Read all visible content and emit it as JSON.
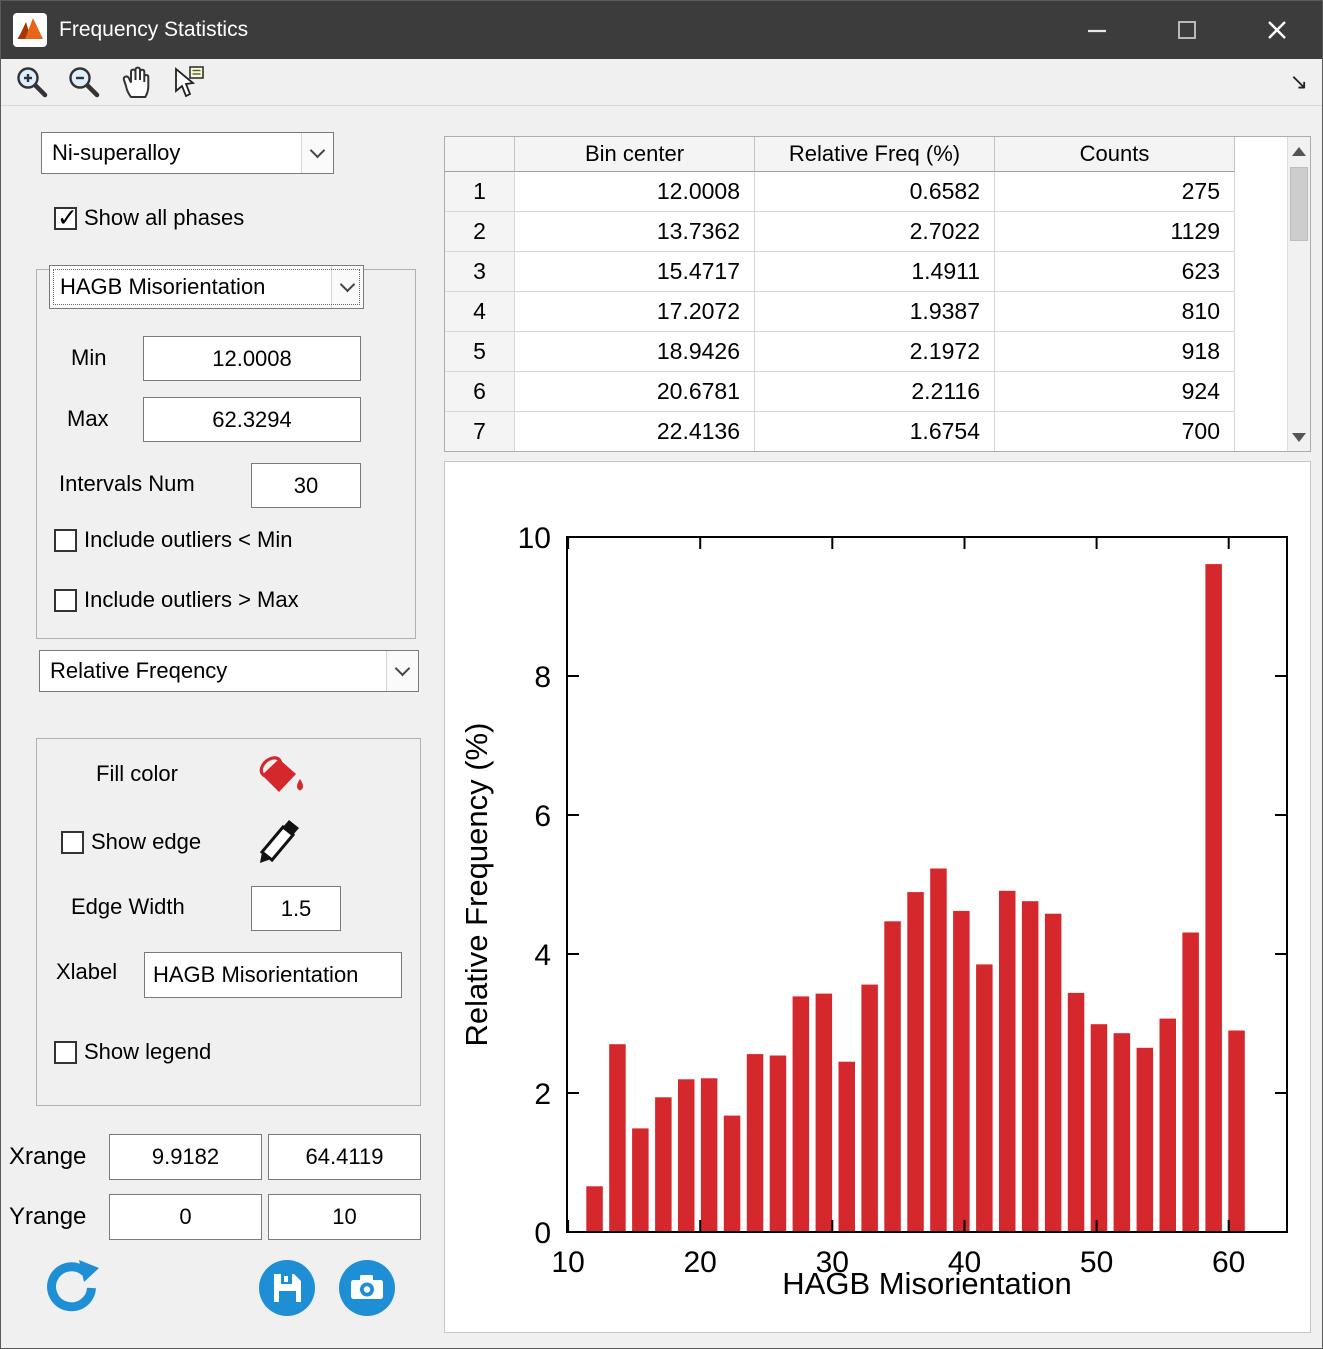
{
  "window": {
    "title": "Frequency Statistics"
  },
  "toolbar": {
    "icons": [
      "zoom-in-icon",
      "zoom-out-icon",
      "pan-hand-icon",
      "data-cursor-icon",
      "dock-arrow-icon"
    ],
    "dock_arrow": "↘"
  },
  "left_panel": {
    "phase_select": "Ni-superalloy",
    "show_all_phases": "Show all phases",
    "show_all_phases_checked": true,
    "property_select": "HAGB Misorientation",
    "min_label": "Min",
    "min_value": "12.0008",
    "max_label": "Max",
    "max_value": "62.3294",
    "intervals_label": "Intervals Num",
    "intervals_value": "30",
    "outlier_min_label": "Include outliers < Min",
    "outlier_min_checked": false,
    "outlier_max_label": "Include outliers > Max",
    "outlier_max_checked": false,
    "freq_select": "Relative Freqency",
    "fill_color_label": "Fill color",
    "fill_color": "#d5282c",
    "show_edge_label": "Show edge",
    "show_edge_checked": false,
    "edge_width_label": "Edge Width",
    "edge_width_value": "1.5",
    "xlabel_label": "Xlabel",
    "xlabel_value": "HAGB Misorientation",
    "show_legend_label": "Show legend",
    "show_legend_checked": false,
    "xrange_label": "Xrange",
    "xrange_min": "9.9182",
    "xrange_max": "64.4119",
    "yrange_label": "Yrange",
    "yrange_min": "0",
    "yrange_max": "10",
    "action_icons": [
      "refresh-icon",
      "save-icon",
      "camera-icon"
    ],
    "accent_blue": "#1e8fd5"
  },
  "table": {
    "headers": [
      "Bin center",
      "Relative Freq (%)",
      "Counts"
    ],
    "rows": [
      [
        "1",
        "12.0008",
        "0.6582",
        "275"
      ],
      [
        "2",
        "13.7362",
        "2.7022",
        "1129"
      ],
      [
        "3",
        "15.4717",
        "1.4911",
        "623"
      ],
      [
        "4",
        "17.2072",
        "1.9387",
        "810"
      ],
      [
        "5",
        "18.9426",
        "2.1972",
        "918"
      ],
      [
        "6",
        "20.6781",
        "2.2116",
        "924"
      ],
      [
        "7",
        "22.4136",
        "1.6754",
        "700"
      ]
    ]
  },
  "chart_data": {
    "type": "bar",
    "title": "",
    "xlabel": "HAGB Misorientation",
    "ylabel": "Relative Frequency (%)",
    "xlim": [
      9.9182,
      64.4119
    ],
    "ylim": [
      0,
      10
    ],
    "xticks": [
      10,
      20,
      30,
      40,
      50,
      60
    ],
    "yticks": [
      0,
      2,
      4,
      6,
      8,
      10
    ],
    "grid": false,
    "legend": false,
    "bar_color": "#d5282c",
    "bin_width": 1.7355,
    "centers": [
      12.0008,
      13.7362,
      15.4717,
      17.2072,
      18.9426,
      20.6781,
      22.4136,
      24.149,
      25.8845,
      27.62,
      29.3554,
      31.0909,
      32.8264,
      34.5618,
      36.2973,
      38.0328,
      39.7682,
      41.5037,
      43.2392,
      44.9746,
      46.7101,
      48.4456,
      50.181,
      51.9165,
      53.652,
      55.3874,
      57.1229,
      58.8584,
      60.5938,
      62.3293
    ],
    "values": [
      0.6582,
      2.7022,
      1.4911,
      1.9387,
      2.1972,
      2.2116,
      1.6754,
      2.56,
      2.54,
      3.39,
      3.43,
      2.45,
      3.56,
      4.47,
      4.89,
      5.23,
      4.62,
      3.85,
      4.91,
      4.76,
      4.58,
      3.44,
      2.99,
      2.86,
      2.65,
      3.07,
      4.31,
      9.61,
      2.9,
      0.0
    ]
  }
}
